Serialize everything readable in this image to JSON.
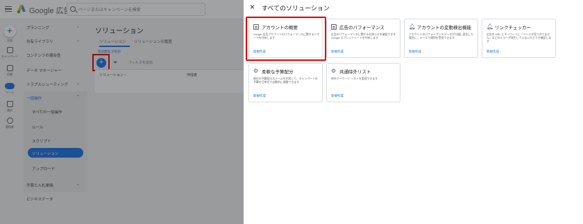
{
  "app": {
    "brand": "Google 広告",
    "search_placeholder": "ページまたはキャンペーンを検索"
  },
  "rail": {
    "items": [
      {
        "label": "作成"
      },
      {
        "label": "キャンペーン"
      },
      {
        "label": "目標"
      },
      {
        "label": "ツール"
      },
      {
        "label": "請求"
      },
      {
        "label": "管理者"
      }
    ]
  },
  "nav": {
    "items": [
      {
        "label": "プランニング"
      },
      {
        "label": "共有ライブラリ"
      },
      {
        "label": "コンテンツの適合性"
      },
      {
        "label": "データ マネージャー"
      },
      {
        "label": "トラブルシューティング"
      },
      {
        "label": "一括操作"
      },
      {
        "label": "予算と入札単価"
      },
      {
        "label": "ビジネスデータ"
      }
    ],
    "sub_items": [
      {
        "label": "すべての一括操作"
      },
      {
        "label": "ルール"
      },
      {
        "label": "スクリプト"
      },
      {
        "label": "ソリューション"
      },
      {
        "label": "アップロード"
      }
    ]
  },
  "content": {
    "title": "ソリューション",
    "tabs": [
      {
        "label": "ソリューション"
      },
      {
        "label": "ソリューションの履歴"
      }
    ],
    "chip_label": "有効無効 が有効",
    "filter_label": "フィルタを追加",
    "table_headers": [
      "ソリューション ↑",
      "作成者"
    ]
  },
  "panel": {
    "title": "すべてのソリューション",
    "cards": [
      {
        "title": "アカウントの概要",
        "icon": "document-icon",
        "desc": "Google 広告アカウントのパフォーマンスに関するレポートを共有します",
        "link": "新規作成"
      },
      {
        "title": "広告のパフォーマンス",
        "icon": "document-icon",
        "desc": "広告のパフォーマンスに関するお知らせを確認できる Google スプレッドシートを共有します",
        "link": "新規作成"
      },
      {
        "title": "アカウントの変動検出機能",
        "icon": "bell-icon",
        "desc": "アカウントのパフォーマンスデータが大幅に変化した場合に、メールで通知を受信できます",
        "link": "新規作成"
      },
      {
        "title": "リンクチェッカー",
        "icon": "bell-icon",
        "desc": "広告の URL とキーワードに「ページが見つかりません」などのエラーが発生していないかどうか確認します",
        "link": "新規作成"
      },
      {
        "title": "柔軟な予算配分",
        "icon": "gear-icon",
        "desc": "現在の予算配分スキームを利用して、キャンペーンの予算を日単位で自動的に調整できます",
        "link": "新規作成"
      },
      {
        "title": "共通除外リスト",
        "icon": "gear-icon",
        "desc": "除外キーワード リストを管理できます",
        "link": "新規作成"
      }
    ]
  }
}
